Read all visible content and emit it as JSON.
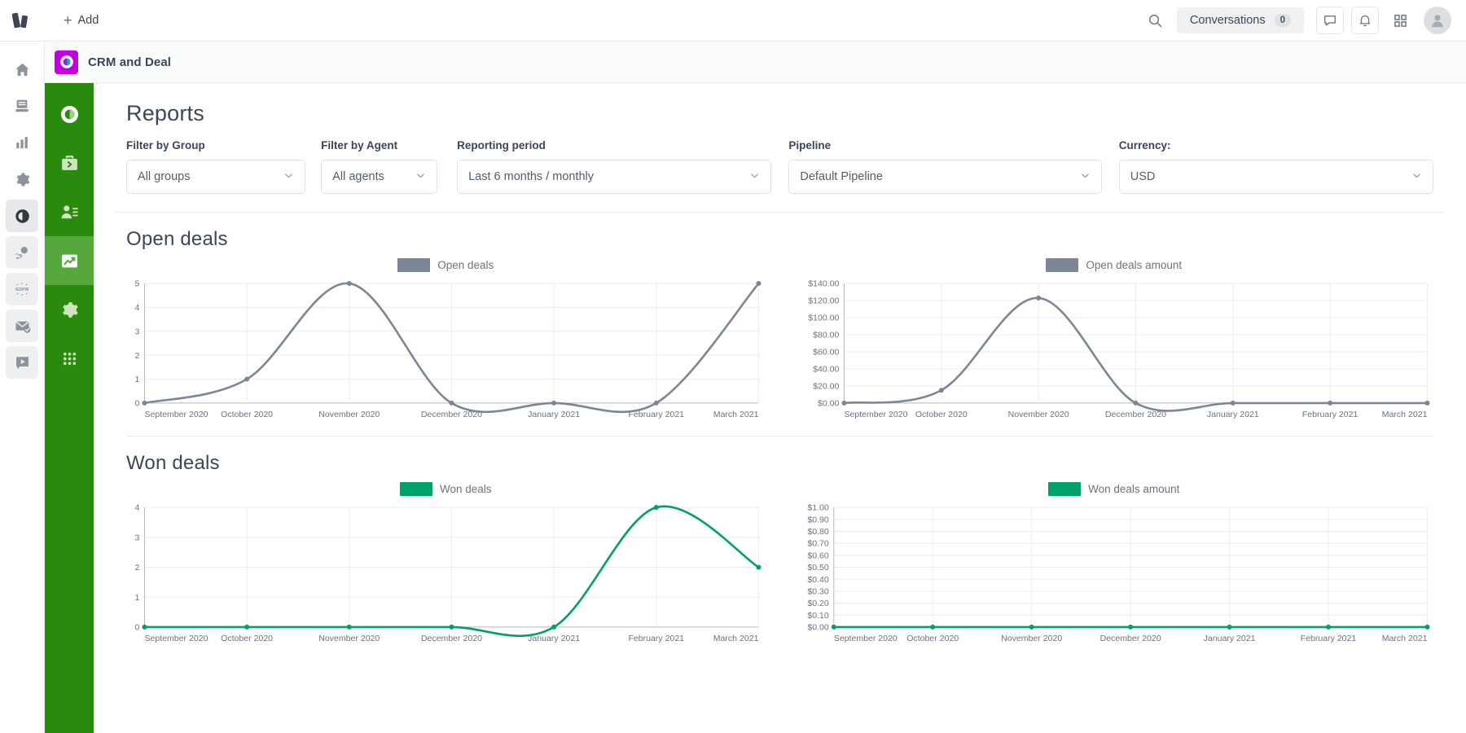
{
  "topbar": {
    "logo_icon": "bitrix-logo-icon",
    "add_label": "Add",
    "add_icon": "plus-icon",
    "search_icon": "search-icon",
    "conversations_label": "Conversations",
    "conversations_count": "0",
    "chat_icon": "chat-bubble-icon",
    "bell_icon": "bell-icon",
    "apps_icon": "grid-apps-icon",
    "avatar_icon": "avatar-icon"
  },
  "rail": {
    "items": [
      {
        "name": "home-icon",
        "label": "Home",
        "active": false
      },
      {
        "name": "feed-icon",
        "label": "Feed",
        "active": false
      },
      {
        "name": "bar-chart-icon",
        "label": "Analytics",
        "active": false
      },
      {
        "name": "gear-icon",
        "label": "Settings",
        "active": false
      },
      {
        "name": "crm-icon",
        "label": "CRM and Deal",
        "active": true
      },
      {
        "name": "marketing-icon",
        "label": "Marketing",
        "active": false
      },
      {
        "name": "gdpr-icon",
        "label": "GDPR",
        "active": false
      },
      {
        "name": "mail-icon",
        "label": "Mail",
        "active": false
      },
      {
        "name": "video-icon",
        "label": "Video",
        "active": false
      }
    ]
  },
  "app": {
    "badge_icon": "crm-app-icon",
    "badge_color": "#c400e3",
    "title": "CRM and Deal"
  },
  "green_sidebar": {
    "items": [
      {
        "name": "crm-logo-icon",
        "label": "CRM",
        "active": false
      },
      {
        "name": "briefcase-icon",
        "label": "Deals",
        "active": false
      },
      {
        "name": "contacts-icon",
        "label": "Contacts",
        "active": false
      },
      {
        "name": "reports-chart-icon",
        "label": "Reports",
        "active": true
      },
      {
        "name": "settings-gear-icon",
        "label": "Settings",
        "active": false
      },
      {
        "name": "apps-grid-icon",
        "label": "Apps",
        "active": false
      }
    ]
  },
  "page": {
    "title": "Reports"
  },
  "filters": [
    {
      "label": "Filter by Group",
      "value": "All groups",
      "name": "filter-by-group"
    },
    {
      "label": "Filter by Agent",
      "value": "All agents",
      "name": "filter-by-agent"
    },
    {
      "label": "Reporting period",
      "value": "Last 6 months / monthly",
      "name": "reporting-period"
    },
    {
      "label": "Pipeline",
      "value": "Default Pipeline",
      "name": "pipeline"
    },
    {
      "label": "Currency:",
      "value": "USD",
      "name": "currency"
    }
  ],
  "sections": [
    {
      "title": "Open deals"
    },
    {
      "title": "Won deals"
    }
  ],
  "colors": {
    "open_series": "#7b8794",
    "won_series": "#00a069",
    "green_sidebar": "#2a8a0e",
    "grid": "#ececec",
    "axis": "#b9b9b9",
    "tick_text": "#6b7280"
  },
  "chart_data": [
    {
      "type": "line",
      "title": "Open deals",
      "legend": "Open deals",
      "legend_position": "top-center",
      "color": "#7b8794",
      "categories": [
        "September 2020",
        "October 2020",
        "November 2020",
        "December 2020",
        "January 2021",
        "February 2021",
        "March 2021"
      ],
      "values": [
        0,
        1,
        5,
        0,
        0,
        0,
        5
      ],
      "yticks": [
        "0",
        "1",
        "2",
        "3",
        "4",
        "5"
      ],
      "ytick_values": [
        0,
        1,
        2,
        3,
        4,
        5
      ],
      "ylim": [
        0,
        5
      ],
      "xlabel": "",
      "ylabel": "",
      "grid": true
    },
    {
      "type": "line",
      "title": "Open deals amount",
      "legend": "Open deals amount",
      "legend_position": "top-center",
      "color": "#7b8794",
      "categories": [
        "September 2020",
        "October 2020",
        "November 2020",
        "December 2020",
        "January 2021",
        "February 2021",
        "March 2021"
      ],
      "values": [
        0,
        15,
        123,
        0,
        0,
        0,
        0
      ],
      "yticks": [
        "$0.00",
        "$20.00",
        "$40.00",
        "$60.00",
        "$80.00",
        "$100.00",
        "$120.00",
        "$140.00"
      ],
      "ytick_values": [
        0,
        20,
        40,
        60,
        80,
        100,
        120,
        140
      ],
      "ylim": [
        0,
        140
      ],
      "xlabel": "",
      "ylabel": "",
      "grid": true
    },
    {
      "type": "line",
      "title": "Won deals",
      "legend": "Won deals",
      "legend_position": "top-center",
      "color": "#00a069",
      "categories": [
        "September 2020",
        "October 2020",
        "November 2020",
        "December 2020",
        "January 2021",
        "February 2021",
        "March 2021"
      ],
      "values": [
        0,
        0,
        0,
        0,
        0,
        4,
        2
      ],
      "yticks": [
        "0",
        "1",
        "2",
        "3",
        "4"
      ],
      "ytick_values": [
        0,
        1,
        2,
        3,
        4
      ],
      "ylim": [
        0,
        4
      ],
      "xlabel": "",
      "ylabel": "",
      "grid": true
    },
    {
      "type": "line",
      "title": "Won deals amount",
      "legend": "Won deals amount",
      "legend_position": "top-center",
      "color": "#00a069",
      "categories": [
        "September 2020",
        "October 2020",
        "November 2020",
        "December 2020",
        "January 2021",
        "February 2021",
        "March 2021"
      ],
      "values": [
        0,
        0,
        0,
        0,
        0,
        0,
        0
      ],
      "yticks": [
        "$0.00",
        "$0.10",
        "$0.20",
        "$0.30",
        "$0.40",
        "$0.50",
        "$0.60",
        "$0.70",
        "$0.80",
        "$0.90",
        "$1.00"
      ],
      "ytick_values": [
        0,
        0.1,
        0.2,
        0.3,
        0.4,
        0.5,
        0.6,
        0.7,
        0.8,
        0.9,
        1.0
      ],
      "ylim": [
        0,
        1
      ],
      "xlabel": "",
      "ylabel": "",
      "grid": true
    }
  ]
}
